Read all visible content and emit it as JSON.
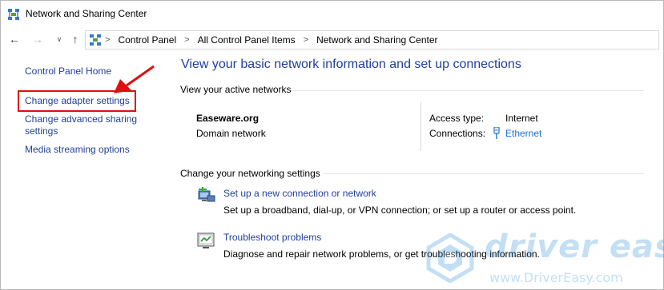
{
  "window": {
    "title": "Network and Sharing Center"
  },
  "address_bar": {
    "crumbs": [
      "Control Panel",
      "All Control Panel Items",
      "Network and Sharing Center"
    ],
    "separator": ">"
  },
  "left_pane": {
    "home": "Control Panel Home",
    "adapter": "Change adapter settings",
    "advanced": "Change advanced sharing settings",
    "media": "Media streaming options",
    "highlight_color": "#e20d0d"
  },
  "main": {
    "title": "View your basic network information and set up connections",
    "active_networks_label": "View your active networks",
    "network_name": "Easeware.org",
    "network_type": "Domain network",
    "access_type_label": "Access type:",
    "access_type_value": "Internet",
    "connections_label": "Connections:",
    "connections_value": "Ethernet",
    "settings_label": "Change your networking settings",
    "tasks": [
      {
        "icon": "network-setup-icon",
        "link": "Set up a new connection or network",
        "description": "Set up a broadband, dial-up, or VPN connection; or set up a router or access point."
      },
      {
        "icon": "troubleshoot-icon",
        "link": "Troubleshoot problems",
        "description": "Diagnose and repair network problems, or get troubleshooting information."
      }
    ]
  },
  "watermark": {
    "brand": "driver easy",
    "url": "www.DriverEasy.com"
  },
  "colors": {
    "link": "#1f3f9a",
    "accent_link": "#1f6fd1",
    "watermark": "#2b8fd8"
  }
}
